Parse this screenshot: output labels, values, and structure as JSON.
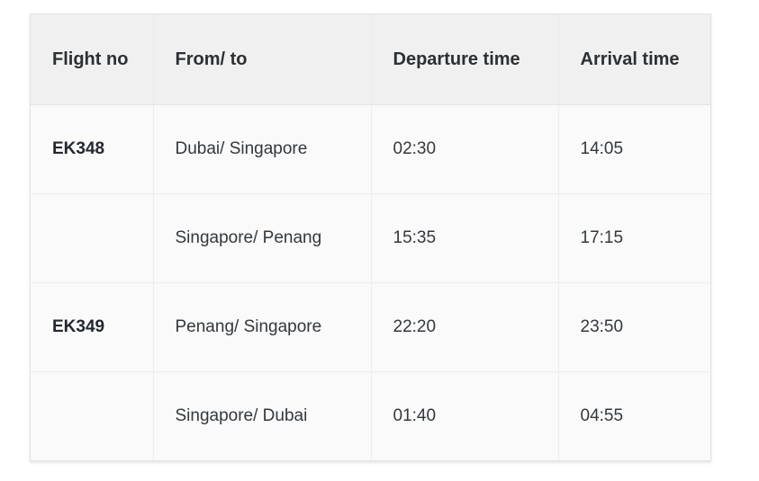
{
  "table": {
    "columns": [
      {
        "key": "flight_no",
        "label": "Flight no"
      },
      {
        "key": "from_to",
        "label": "From/ to"
      },
      {
        "key": "departure_time",
        "label": "Departure time"
      },
      {
        "key": "arrival_time",
        "label": "Arrival time"
      }
    ],
    "rows": [
      {
        "flight_no": "EK348",
        "from_to": "Dubai/ Singapore",
        "departure_time": "02:30",
        "arrival_time": "14:05"
      },
      {
        "flight_no": "",
        "from_to": "Singapore/ Penang",
        "departure_time": "15:35",
        "arrival_time": "17:15"
      },
      {
        "flight_no": "EK349",
        "from_to": "Penang/ Singapore",
        "departure_time": "22:20",
        "arrival_time": "23:50"
      },
      {
        "flight_no": "",
        "from_to": "Singapore/ Dubai",
        "departure_time": "01:40",
        "arrival_time": "04:55"
      }
    ]
  },
  "colors": {
    "header_background": "#f0f0f0",
    "body_background": "#fafafa",
    "border": "#ededed",
    "outer_border": "#e2e2e2",
    "header_text": "#2b3034",
    "body_text": "#33383d"
  }
}
